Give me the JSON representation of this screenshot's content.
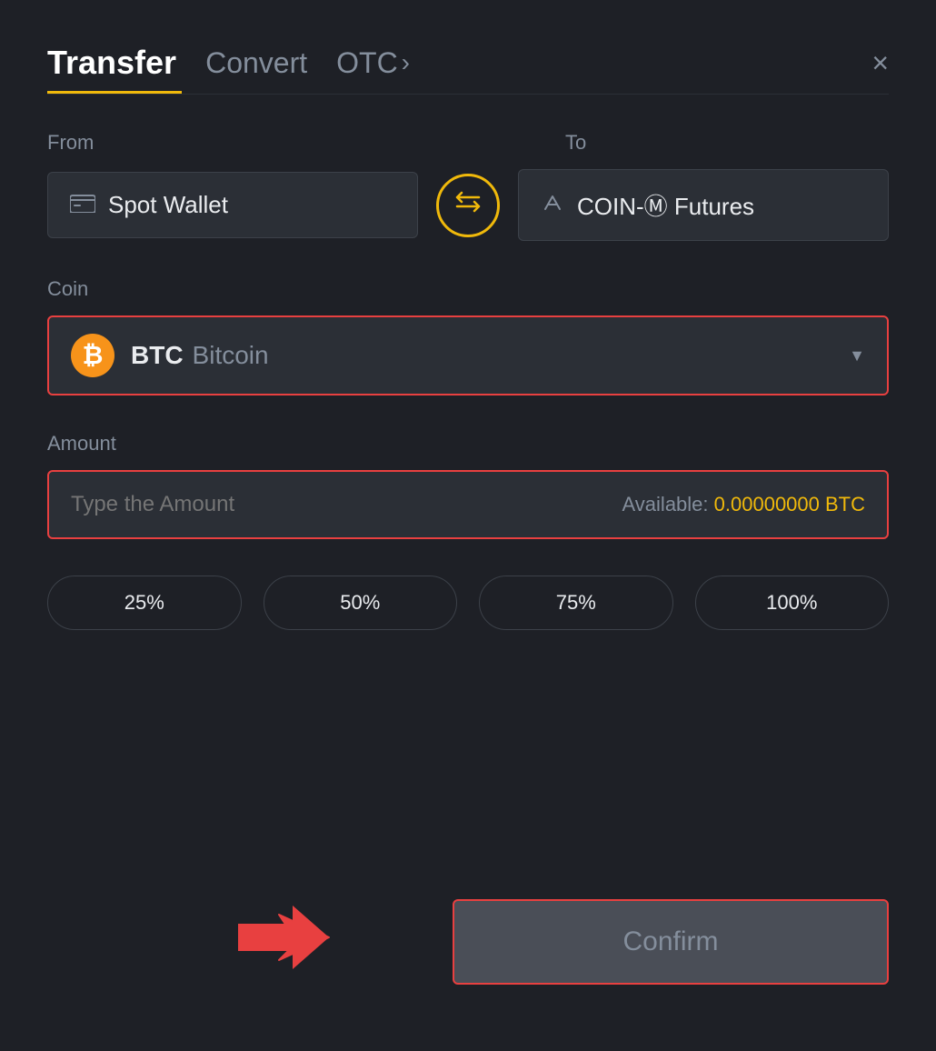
{
  "header": {
    "tab_transfer": "Transfer",
    "tab_convert": "Convert",
    "tab_otc": "OTC",
    "tab_otc_arrow": "›",
    "close_label": "×"
  },
  "from_section": {
    "label": "From",
    "wallet_name": "Spot Wallet"
  },
  "to_section": {
    "label": "To",
    "wallet_name": "COIN-Ⓜ Futures"
  },
  "coin_section": {
    "label": "Coin",
    "coin_symbol": "BTC",
    "coin_name": "Bitcoin",
    "coin_icon": "₿"
  },
  "amount_section": {
    "label": "Amount",
    "placeholder": "Type the Amount",
    "available_label": "Available:",
    "available_amount": "0.00000000 BTC"
  },
  "percent_buttons": {
    "p25": "25%",
    "p50": "50%",
    "p75": "75%",
    "p100": "100%"
  },
  "confirm_button": {
    "label": "Confirm"
  },
  "colors": {
    "accent": "#f0b90b",
    "danger": "#e84040",
    "bg": "#1e2026",
    "surface": "#2b2f36"
  }
}
